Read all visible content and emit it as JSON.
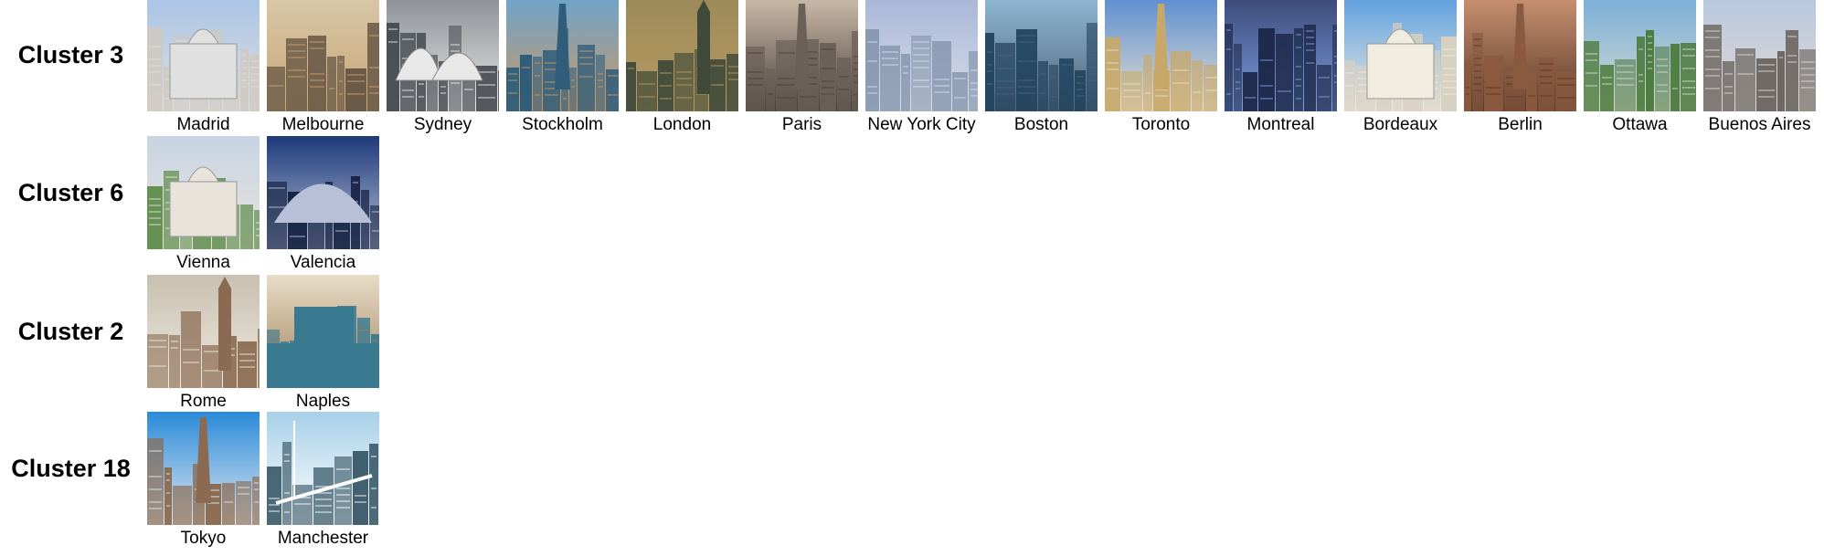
{
  "clusters": [
    {
      "label": "Cluster 3",
      "cities": [
        {
          "name": "Madrid",
          "icon": "building-dome-icon",
          "sky": "#a9c4e6",
          "ground": "#cfc8c0",
          "accent": "#e0e0e0"
        },
        {
          "name": "Melbourne",
          "icon": "skyscrapers-icon",
          "sky": "#d8c7a8",
          "ground": "#6b5a48",
          "accent": "#c9a574"
        },
        {
          "name": "Sydney",
          "icon": "opera-house-icon",
          "sky": "#8d9196",
          "ground": "#4a4f55",
          "accent": "#e8e8e8"
        },
        {
          "name": "Stockholm",
          "icon": "church-spire-icon",
          "sky": "#6fa4c8",
          "ground": "#2f5d7a",
          "accent": "#c89868"
        },
        {
          "name": "London",
          "icon": "clock-tower-icon",
          "sky": "#9c8a5a",
          "ground": "#3f4a3a",
          "accent": "#b89a60"
        },
        {
          "name": "Paris",
          "icon": "eiffel-tower-icon",
          "sky": "#c9b9a8",
          "ground": "#6a6058",
          "accent": "#4a4038"
        },
        {
          "name": "New York City",
          "icon": "skyline-icon",
          "sky": "#a9b7d8",
          "ground": "#7d8fa8",
          "accent": "#d8dee8"
        },
        {
          "name": "Boston",
          "icon": "skyscrapers-icon",
          "sky": "#8fb6d2",
          "ground": "#24455f",
          "accent": "#4e6478"
        },
        {
          "name": "Toronto",
          "icon": "cn-tower-icon",
          "sky": "#5d8fd0",
          "ground": "#c8a868",
          "accent": "#e8e0d0"
        },
        {
          "name": "Montreal",
          "icon": "night-skyline-icon",
          "sky": "#3c4a7a",
          "ground": "#1e2a4a",
          "accent": "#7fa0e0"
        },
        {
          "name": "Bordeaux",
          "icon": "palace-dome-icon",
          "sky": "#5fa0e0",
          "ground": "#d8d0c0",
          "accent": "#f0ece0"
        },
        {
          "name": "Berlin",
          "icon": "tv-tower-icon",
          "sky": "#c89070",
          "ground": "#8a5a40",
          "accent": "#5a3828"
        },
        {
          "name": "Ottawa",
          "icon": "aerial-city-icon",
          "sky": "#7ab0d8",
          "ground": "#4a7a3a",
          "accent": "#d8d8d0"
        },
        {
          "name": "Buenos Aires",
          "icon": "street-icon",
          "sky": "#b8c8e0",
          "ground": "#6a6460",
          "accent": "#e0d8d0"
        }
      ]
    },
    {
      "label": "Cluster 6",
      "cities": [
        {
          "name": "Vienna",
          "icon": "palace-park-icon",
          "sky": "#c8d4e4",
          "ground": "#5a8a48",
          "accent": "#e8e4dc"
        },
        {
          "name": "Valencia",
          "icon": "modern-arch-icon",
          "sky": "#1e3a7a",
          "ground": "#0e1a3a",
          "accent": "#b8c0d8"
        }
      ]
    },
    {
      "label": "Cluster 2",
      "cities": [
        {
          "name": "Rome",
          "icon": "monument-icon",
          "sky": "#c8c0b0",
          "ground": "#8a6a50",
          "accent": "#eeeae0"
        },
        {
          "name": "Naples",
          "icon": "castle-sea-icon",
          "sky": "#e8ddc8",
          "ground": "#3a7a90",
          "accent": "#a08058"
        }
      ]
    },
    {
      "label": "Cluster 18",
      "cities": [
        {
          "name": "Tokyo",
          "icon": "skytree-icon",
          "sky": "#2a8ad8",
          "ground": "#8a6a50",
          "accent": "#e0e8f0"
        },
        {
          "name": "Manchester",
          "icon": "bridge-icon",
          "sky": "#a8d0e8",
          "ground": "#3a5a6a",
          "accent": "#ffffff"
        }
      ]
    }
  ]
}
